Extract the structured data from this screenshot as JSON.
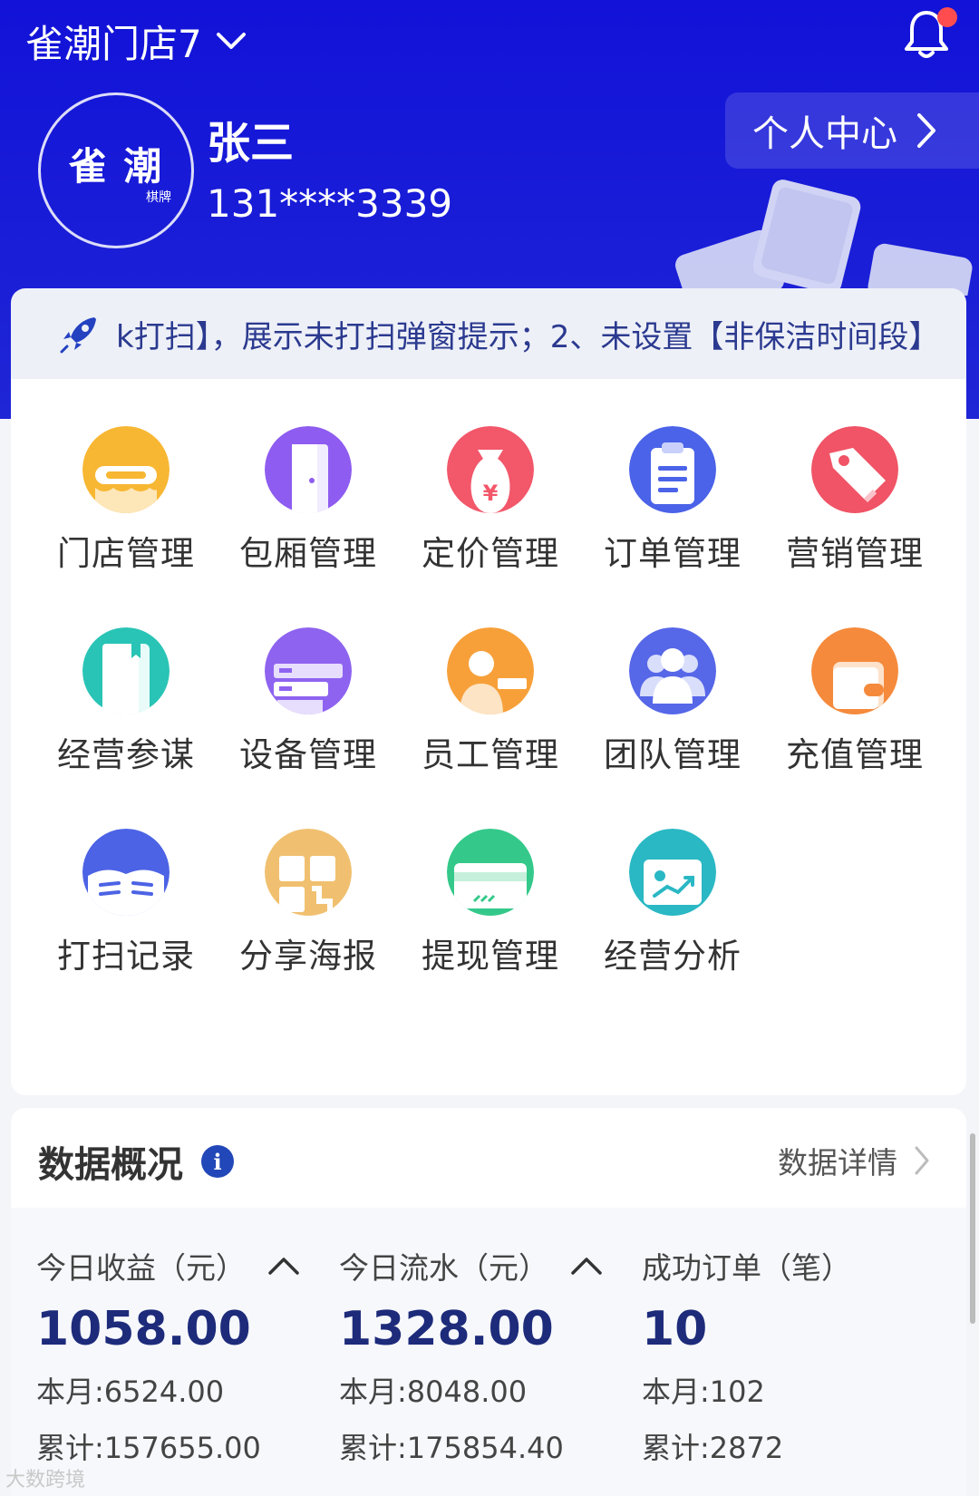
{
  "header": {
    "store_name": "雀潮门店7",
    "user_name": "张三",
    "user_phone": "131****3339",
    "personal_center_label": "个人中心",
    "avatar_logo": "雀 潮",
    "avatar_sub": "棋牌"
  },
  "notice": {
    "text": "k打扫】，展示未打扫弹窗提示；2、未设置【非保洁时间段】"
  },
  "menu": {
    "items": [
      {
        "label": "门店管理",
        "icon": "store-icon",
        "color": "#f7b733"
      },
      {
        "label": "包厢管理",
        "icon": "door-icon",
        "color": "#8e5cf0"
      },
      {
        "label": "定价管理",
        "icon": "money-bag-icon",
        "color": "#f2576a"
      },
      {
        "label": "订单管理",
        "icon": "clipboard-icon",
        "color": "#4b63e8"
      },
      {
        "label": "营销管理",
        "icon": "tag-icon",
        "color": "#f05466"
      },
      {
        "label": "经营参谋",
        "icon": "book-icon",
        "color": "#29c4b6"
      },
      {
        "label": "设备管理",
        "icon": "device-icon",
        "color": "#8e63f0"
      },
      {
        "label": "员工管理",
        "icon": "staff-icon",
        "color": "#f7a03a"
      },
      {
        "label": "团队管理",
        "icon": "team-icon",
        "color": "#5667e8"
      },
      {
        "label": "充值管理",
        "icon": "wallet-icon",
        "color": "#f58a3c"
      },
      {
        "label": "打扫记录",
        "icon": "record-icon",
        "color": "#4c63e5"
      },
      {
        "label": "分享海报",
        "icon": "poster-icon",
        "color": "#f0c070"
      },
      {
        "label": "提现管理",
        "icon": "card-icon",
        "color": "#34c98a"
      },
      {
        "label": "经营分析",
        "icon": "analysis-icon",
        "color": "#2ab8c4"
      }
    ]
  },
  "data_overview": {
    "title": "数据概况",
    "detail_label": "数据详情",
    "stats": [
      {
        "label": "今日收益（元）",
        "value": "1058.00",
        "month": "本月:6524.00",
        "total": "累计:157655.00",
        "expandable": true
      },
      {
        "label": "今日流水（元）",
        "value": "1328.00",
        "month": "本月:8048.00",
        "total": "累计:175854.40",
        "expandable": true
      },
      {
        "label": "成功订单（笔）",
        "value": "10",
        "month": "本月:102",
        "total": "累计:2872",
        "expandable": false
      }
    ]
  },
  "watermark": "大数跨境"
}
